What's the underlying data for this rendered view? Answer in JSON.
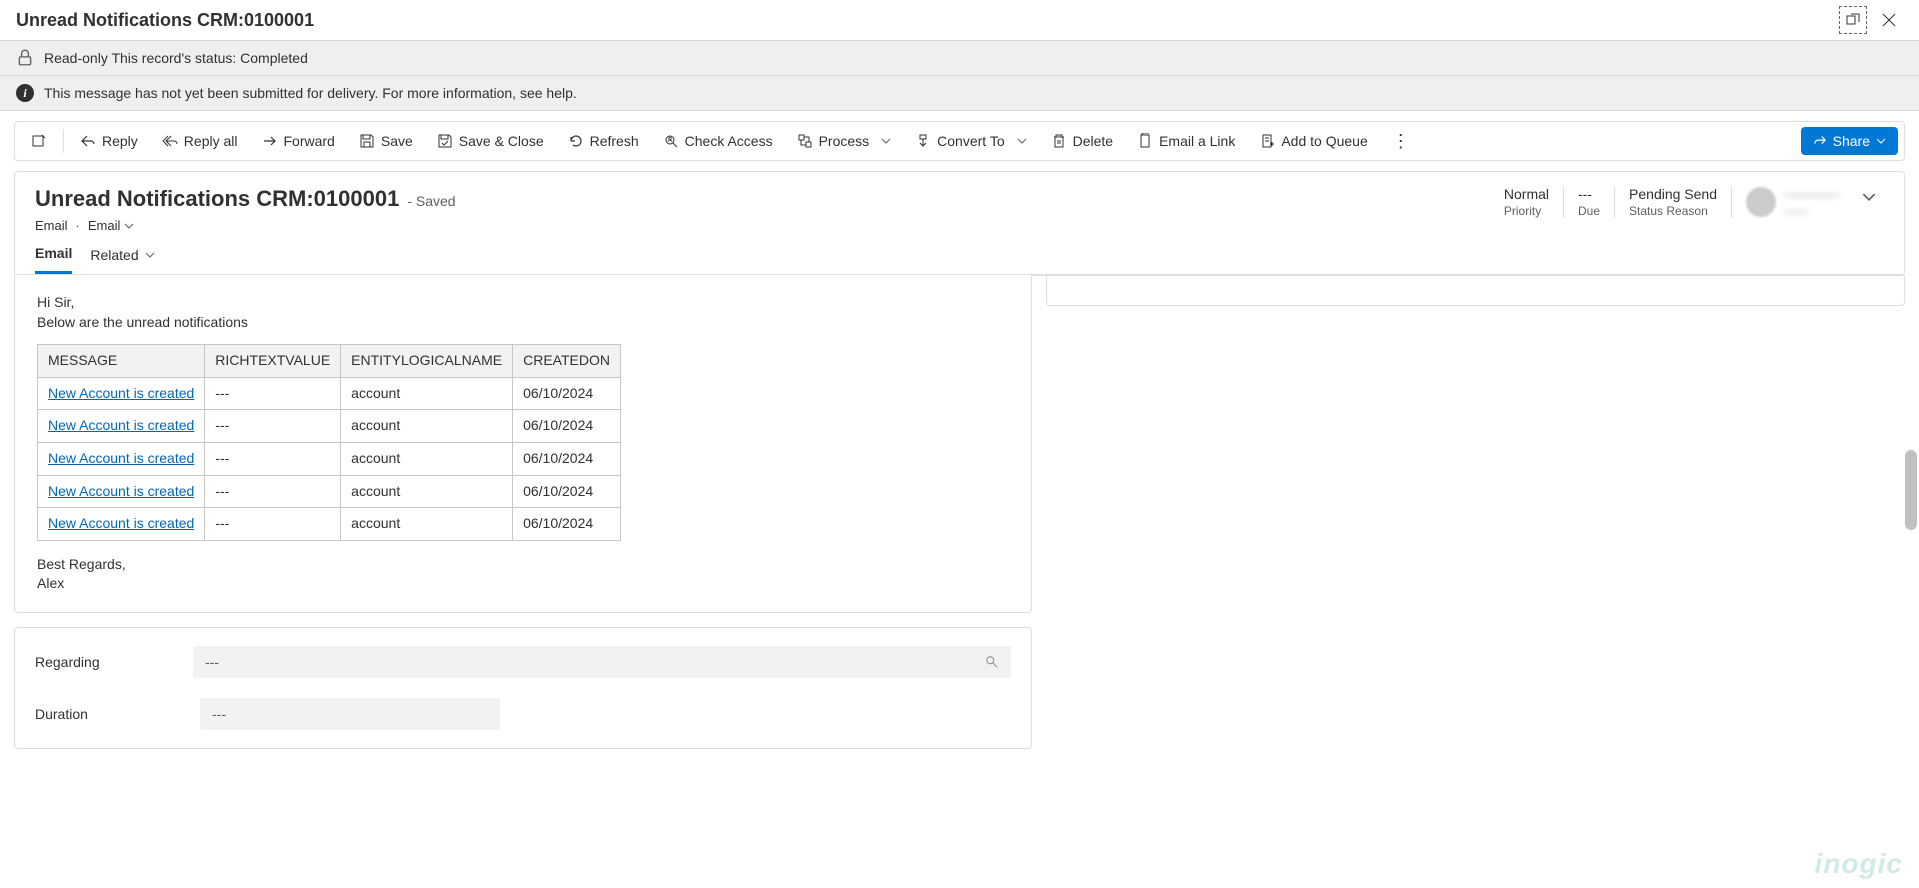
{
  "titlebar": {
    "title": "Unread Notifications CRM:0100001"
  },
  "infobar1": {
    "text": "Read-only This record's status: Completed"
  },
  "infobar2": {
    "text": "This message has not yet been submitted for delivery. For more information, see help."
  },
  "commands": {
    "reply": "Reply",
    "reply_all": "Reply all",
    "forward": "Forward",
    "save": "Save",
    "save_close": "Save & Close",
    "refresh": "Refresh",
    "check_access": "Check Access",
    "process": "Process",
    "convert_to": "Convert To",
    "delete": "Delete",
    "email_link": "Email a Link",
    "add_queue": "Add to Queue",
    "share": "Share"
  },
  "form": {
    "title": "Unread Notifications CRM:0100001",
    "saved": "- Saved",
    "entity": "Email",
    "selector": "Email",
    "priority_val": "Normal",
    "priority_lab": "Priority",
    "due_val": "---",
    "due_lab": "Due",
    "status_val": "Pending Send",
    "status_lab": "Status Reason",
    "owner_name": "————",
    "owner_sub": "——"
  },
  "tabs": {
    "email": "Email",
    "related": "Related"
  },
  "body": {
    "greeting": "Hi Sir,",
    "intro": "Below are the unread notifications",
    "columns": {
      "message": "MESSAGE",
      "richtext": "RICHTEXTVALUE",
      "entity": "ENTITYLOGICALNAME",
      "created": "CREATEDON"
    },
    "rows": [
      {
        "message": "New Account is created",
        "richtext": "---",
        "entity": "account",
        "created": "06/10/2024"
      },
      {
        "message": "New Account is created",
        "richtext": "---",
        "entity": "account",
        "created": "06/10/2024"
      },
      {
        "message": "New Account is created",
        "richtext": "---",
        "entity": "account",
        "created": "06/10/2024"
      },
      {
        "message": "New Account is created",
        "richtext": "---",
        "entity": "account",
        "created": "06/10/2024"
      },
      {
        "message": "New Account is created",
        "richtext": "---",
        "entity": "account",
        "created": "06/10/2024"
      }
    ],
    "regards1": "Best Regards,",
    "regards2": "Alex"
  },
  "fields": {
    "regarding_label": "Regarding",
    "regarding_value": "---",
    "duration_label": "Duration",
    "duration_value": "---"
  },
  "watermark": "inogic"
}
